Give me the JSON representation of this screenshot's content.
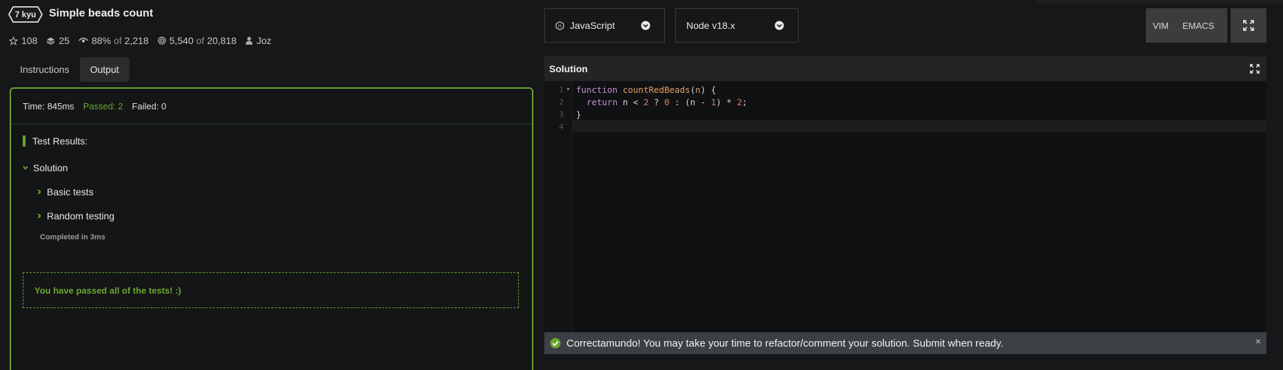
{
  "kata": {
    "rank": "7 kyu",
    "title": "Simple beads count"
  },
  "stats": {
    "stars": "108",
    "collections": "25",
    "satisfaction_percent": "88%",
    "satisfaction_of": "of",
    "satisfaction_votes": "2,218",
    "completed": "5,540",
    "completed_of": "of",
    "attempted": "20,818",
    "author": "Joz"
  },
  "tabs": [
    {
      "label": "Instructions",
      "active": false
    },
    {
      "label": "Output",
      "active": true
    }
  ],
  "output": {
    "time_label": "Time: 845ms",
    "passed_label": "Passed: 2",
    "failed_label": "Failed: 0",
    "results_heading": "Test Results:",
    "group": "Solution",
    "tests": [
      "Basic tests",
      "Random testing"
    ],
    "completed_in": "Completed in 3ms",
    "pass_message": "You have passed all of the tests! :)"
  },
  "toolbar": {
    "language": "JavaScript",
    "runtime": "Node v18.x",
    "vim_label": "VIM",
    "emacs_label": "EMACS"
  },
  "solution": {
    "title": "Solution",
    "line_numbers": [
      "1",
      "2",
      "3",
      "4"
    ]
  },
  "toast": {
    "message": "Correctamundo! You may take your time to refactor/comment your solution. Submit when ready.",
    "close": "×"
  },
  "colors": {
    "accent_green": "#6aa72f",
    "background": "#161719",
    "editor_bg": "#101113"
  }
}
